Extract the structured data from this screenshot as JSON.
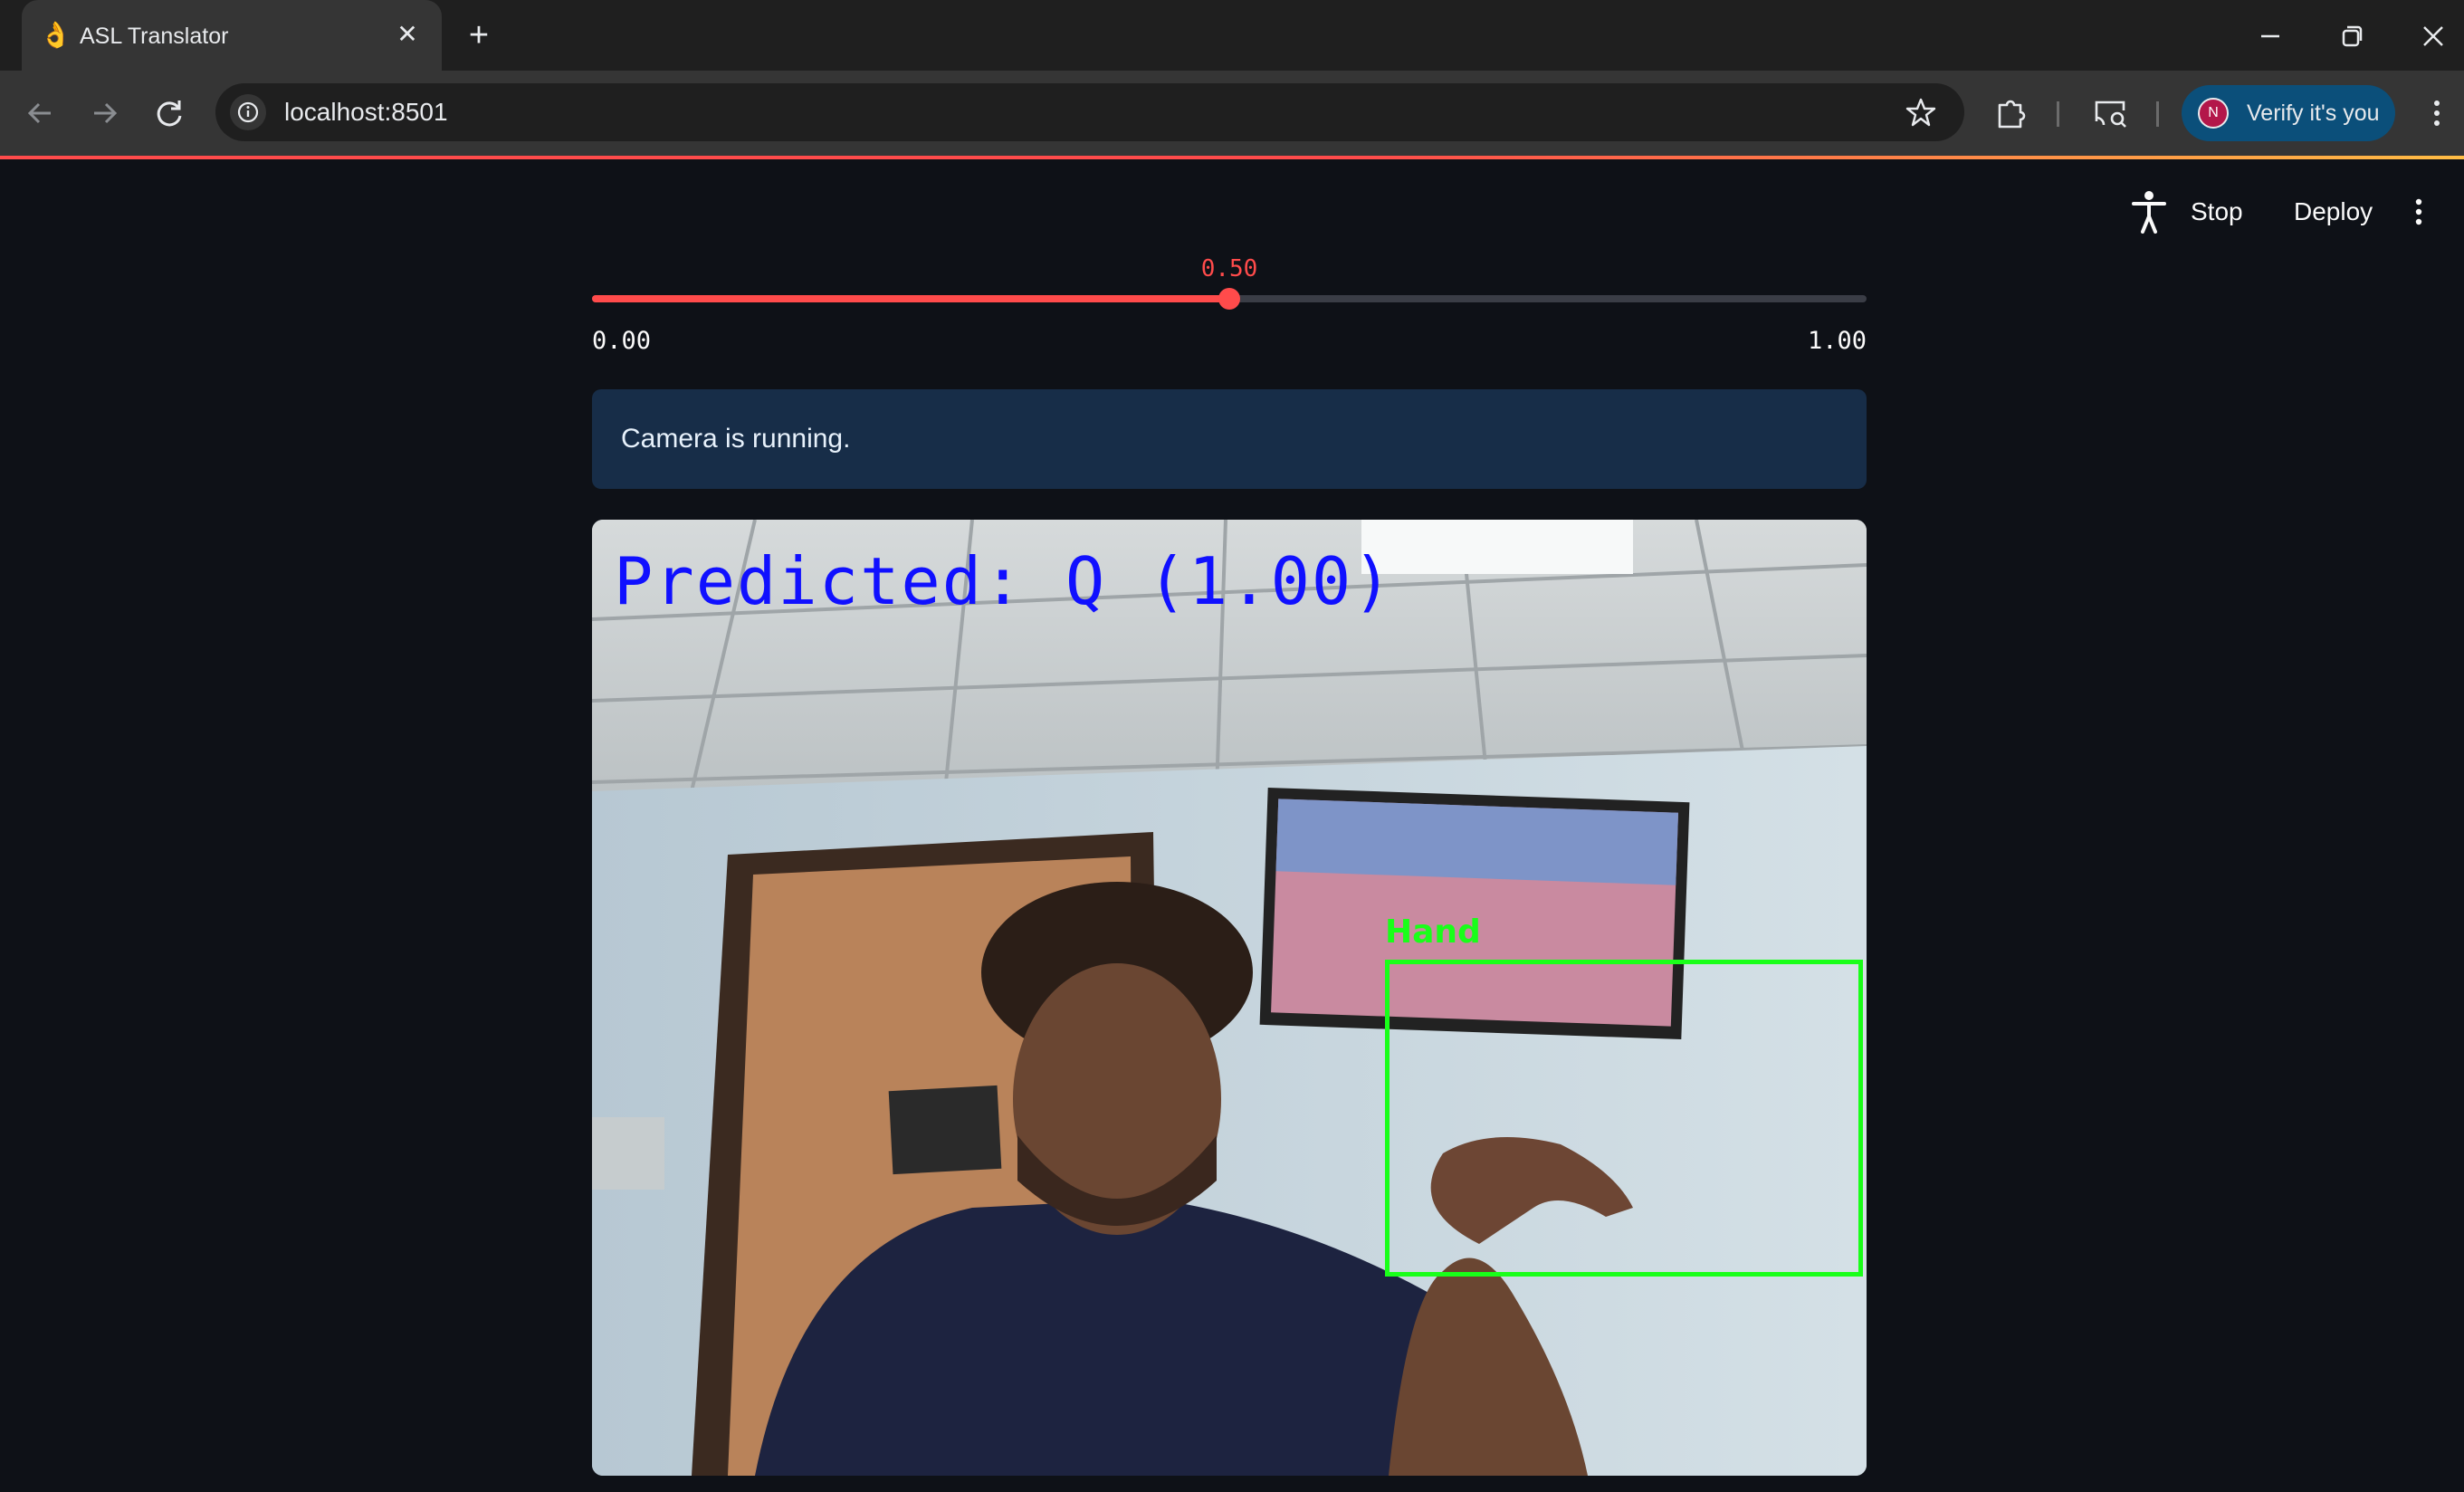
{
  "browser": {
    "tab_title": "ASL Translator",
    "tab_favicon": "👌",
    "new_tab_symbol": "+",
    "close_symbol": "✕",
    "url": "localhost:8501",
    "profile_button": "Verify it's you",
    "profile_initial": "N"
  },
  "header": {
    "stop_label": "Stop",
    "deploy_label": "Deploy"
  },
  "slider": {
    "value_text": "0.50",
    "value": 0.5,
    "min": 0.0,
    "max": 1.0,
    "min_label": "0.00",
    "max_label": "1.00"
  },
  "alert": {
    "text": "Camera is running."
  },
  "camera": {
    "prediction_text": "Predicted: Q (1.00)",
    "detection_label": "Hand"
  },
  "colors": {
    "accent": "#ff4b4b",
    "background": "#0e1117",
    "info_bg": "#172d48",
    "detection_box": "#19ff19",
    "prediction_text": "#1010ff",
    "profile_button_bg": "#0b4f7a"
  },
  "icons": {
    "back": "arrow-left-icon",
    "forward": "arrow-right-icon",
    "reload": "reload-icon",
    "site_info": "info-circle-icon",
    "bookmark": "star-icon",
    "extensions": "puzzle-icon",
    "cast": "cast-search-icon",
    "browser_menu": "kebab-menu-icon",
    "accessibility": "accessibility-icon",
    "app_menu": "kebab-menu-icon"
  }
}
